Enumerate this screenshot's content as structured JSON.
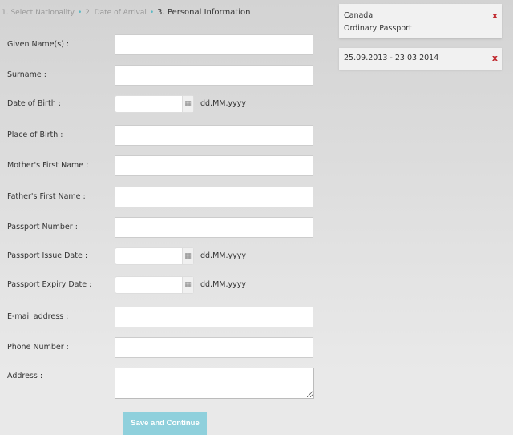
{
  "steps": [
    "1. Select Nationality",
    "2. Date of Arrival",
    "3. Personal Information"
  ],
  "fields": [
    {
      "label": "Given Name(s) :",
      "type": "text"
    },
    {
      "label": "Surname :",
      "type": "text"
    },
    {
      "label": "Date of Birth :",
      "type": "date",
      "format": "dd.MM.yyyy"
    },
    {
      "label": "Place of Birth :",
      "type": "text"
    },
    {
      "label": "Mother's First Name :",
      "type": "text"
    },
    {
      "label": "Father's First Name :",
      "type": "text"
    },
    {
      "label": "Passport Number :",
      "type": "text"
    },
    {
      "label": "Passport Issue Date :",
      "type": "date",
      "format": "dd.MM.yyyy"
    },
    {
      "label": "Passport Expiry Date :",
      "type": "date",
      "format": "dd.MM.yyyy"
    },
    {
      "label": "E-mail address :",
      "type": "text"
    },
    {
      "label": "Phone Number :",
      "type": "text"
    },
    {
      "label": "Address :",
      "type": "textarea"
    }
  ],
  "submit_label": "Save and Continue",
  "summary": {
    "nationality": "Canada",
    "passport_type": "Ordinary Passport",
    "dates": "25.09.2013 - 23.03.2014",
    "remove_label": "x"
  },
  "colors": {
    "accent": "#8fd0dc",
    "remove": "#c0272d"
  }
}
